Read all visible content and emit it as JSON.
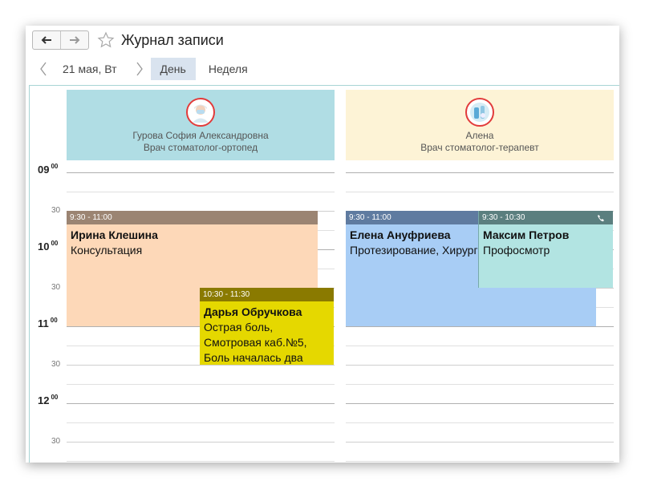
{
  "window": {
    "title": "Журнал записи"
  },
  "datebar": {
    "date": "21 мая, Вт",
    "tab_day": "День",
    "tab_week": "Неделя",
    "active_tab": "day"
  },
  "resources": [
    {
      "name": "Гурова София Александровна",
      "role": "Врач стоматолог-ортопед",
      "color": "#b0dde4"
    },
    {
      "name": "Алена",
      "role": "Врач стоматолог-терапевт",
      "color": "#fdf3d6"
    }
  ],
  "times": {
    "h09": "09",
    "h10": "10",
    "h11": "11",
    "h12": "12",
    "sup": "00",
    "half": "30"
  },
  "events": [
    {
      "time": "9:30 - 11:00",
      "name": "Ирина Клешина",
      "desc": "Консультация",
      "head_color": "#9b8472",
      "body_color": "#fdd8b8"
    },
    {
      "time": "10:30 - 11:30",
      "name": "Дарья Обручкова",
      "desc": "Острая боль,\nСмотровая каб.№5,\nБоль началась два",
      "head_color": "#8a7a00",
      "body_color": "#e5d800"
    },
    {
      "time": "9:30 - 11:00",
      "name": "Елена Ануфриева",
      "desc": "Протезирование, Хирург",
      "head_color": "#5f7ba0",
      "body_color": "#a8cdf5"
    },
    {
      "time": "9:30 - 10:30",
      "name": "Максим Петров",
      "desc": "Профосмотр",
      "head_color": "#5b7f7f",
      "body_color": "#b2e4e2",
      "icon": "phone-icon"
    }
  ]
}
